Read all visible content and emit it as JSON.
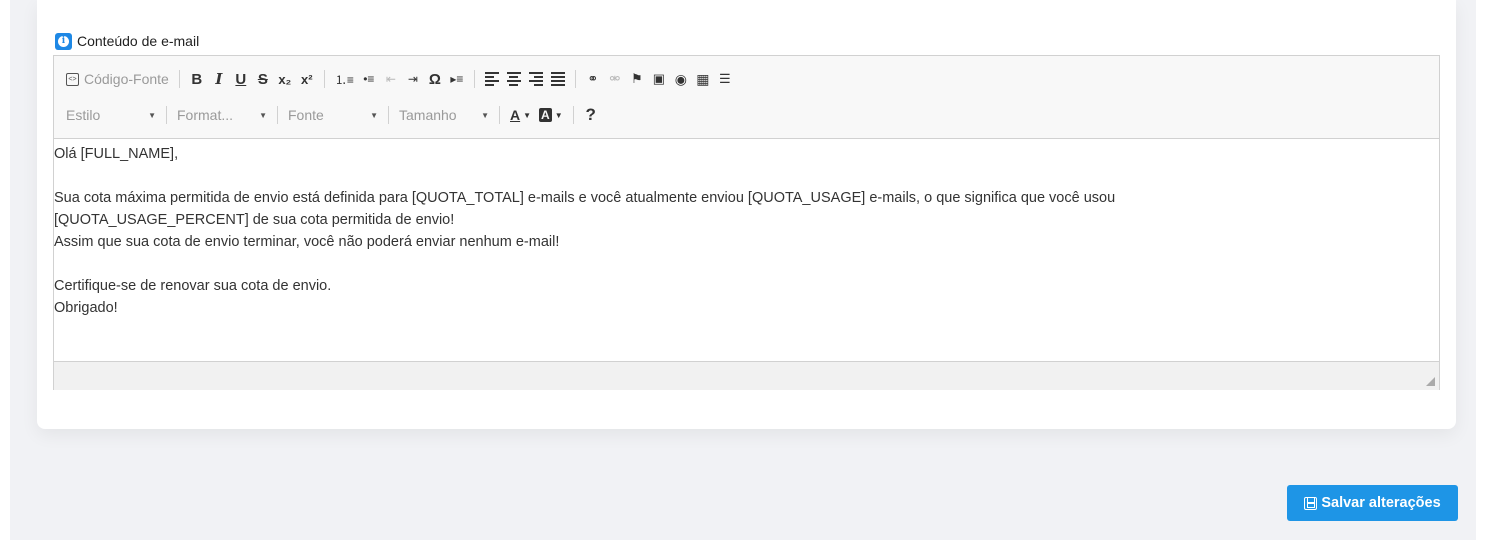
{
  "section": {
    "title": "Conteúdo de e-mail",
    "icon": "info-icon"
  },
  "toolbar": {
    "source_label": "Código-Fonte",
    "bold": "B",
    "italic": "I",
    "underline": "U",
    "strike": "S",
    "subscript": "x₂",
    "superscript": "x²",
    "special_char": "Ω",
    "style_label": "Estilo",
    "format_label": "Format...",
    "font_label": "Fonte",
    "size_label": "Tamanho",
    "text_color": "A",
    "bg_color": "A",
    "help": "?"
  },
  "content": {
    "lines": [
      "Olá [FULL_NAME],",
      "",
      "Sua cota máxima permitida de envio está definida para [QUOTA_TOTAL] e-mails e você atualmente enviou [QUOTA_USAGE] e-mails, o que significa que você usou",
      "[QUOTA_USAGE_PERCENT] de sua cota permitida de envio!",
      "Assim que sua cota de envio terminar, você não poderá enviar nenhum e-mail!",
      "",
      "Certifique-se de renovar sua cota de envio.",
      "Obrigado!"
    ]
  },
  "actions": {
    "save_label": "Salvar alterações"
  },
  "colors": {
    "accent": "#1e95e6",
    "background": "#f1f2f5"
  }
}
